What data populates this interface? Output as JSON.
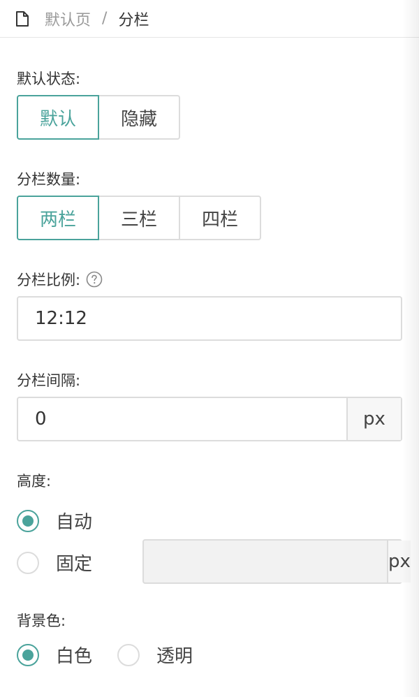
{
  "breadcrumb": {
    "home": "默认页",
    "separator": "/",
    "current": "分栏"
  },
  "default_state": {
    "label": "默认状态:",
    "options": [
      "默认",
      "隐藏"
    ],
    "selected": 0
  },
  "columns_count": {
    "label": "分栏数量:",
    "options": [
      "两栏",
      "三栏",
      "四栏"
    ],
    "selected": 0
  },
  "ratio": {
    "label": "分栏比例:",
    "value": "12:12",
    "help_icon": "question-circle-icon"
  },
  "gap": {
    "label": "分栏间隔:",
    "value": "0",
    "unit": "px"
  },
  "height": {
    "label": "高度:",
    "options": [
      "自动",
      "固定"
    ],
    "selected": 0,
    "fixed_value": "",
    "unit": "px"
  },
  "background": {
    "label": "背景色:",
    "options": [
      "白色",
      "透明"
    ],
    "selected": 0
  },
  "colors": {
    "accent": "#4aa39b",
    "border": "#dcdcdc",
    "text": "#333333",
    "muted": "#999999"
  }
}
